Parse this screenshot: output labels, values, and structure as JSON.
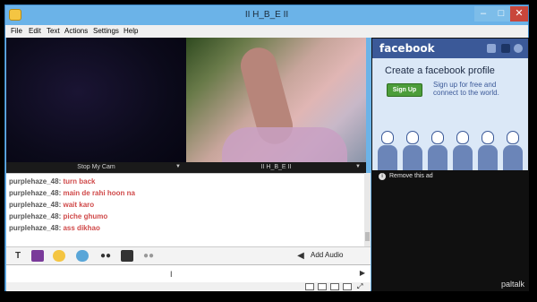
{
  "window": {
    "title": "II H_B_E II"
  },
  "menu": [
    "File",
    "Edit",
    "Text",
    "Actions",
    "Settings",
    "Help"
  ],
  "video": {
    "left_label": "Stop My Cam",
    "right_label": "II H_B_E II"
  },
  "chat": {
    "messages": [
      {
        "user": "purplehaze_48:",
        "text": "turn back"
      },
      {
        "user": "purplehaze_48:",
        "text": "main de rahi hoon na"
      },
      {
        "user": "purplehaze_48:",
        "text": "wait karo"
      },
      {
        "user": "purplehaze_48:",
        "text": "piche ghumo"
      },
      {
        "user": "purplehaze_48:",
        "text": "ass dikhao"
      }
    ],
    "input_value": ""
  },
  "toolbar": {
    "add_audio_label": "Add Audio"
  },
  "ad": {
    "brand": "facebook",
    "headline": "Create a facebook profile",
    "signup_label": "Sign Up",
    "subtext": "Sign up for free and connect to the world.",
    "remove_label": "Remove this ad",
    "footer_logo": "paltalk"
  },
  "colors": {
    "titlebar": "#6bb3e8",
    "facebook_blue": "#3b5998",
    "chat_user": "#555555",
    "chat_text": "#d04a4a",
    "signup_green": "#4c9d3a"
  }
}
